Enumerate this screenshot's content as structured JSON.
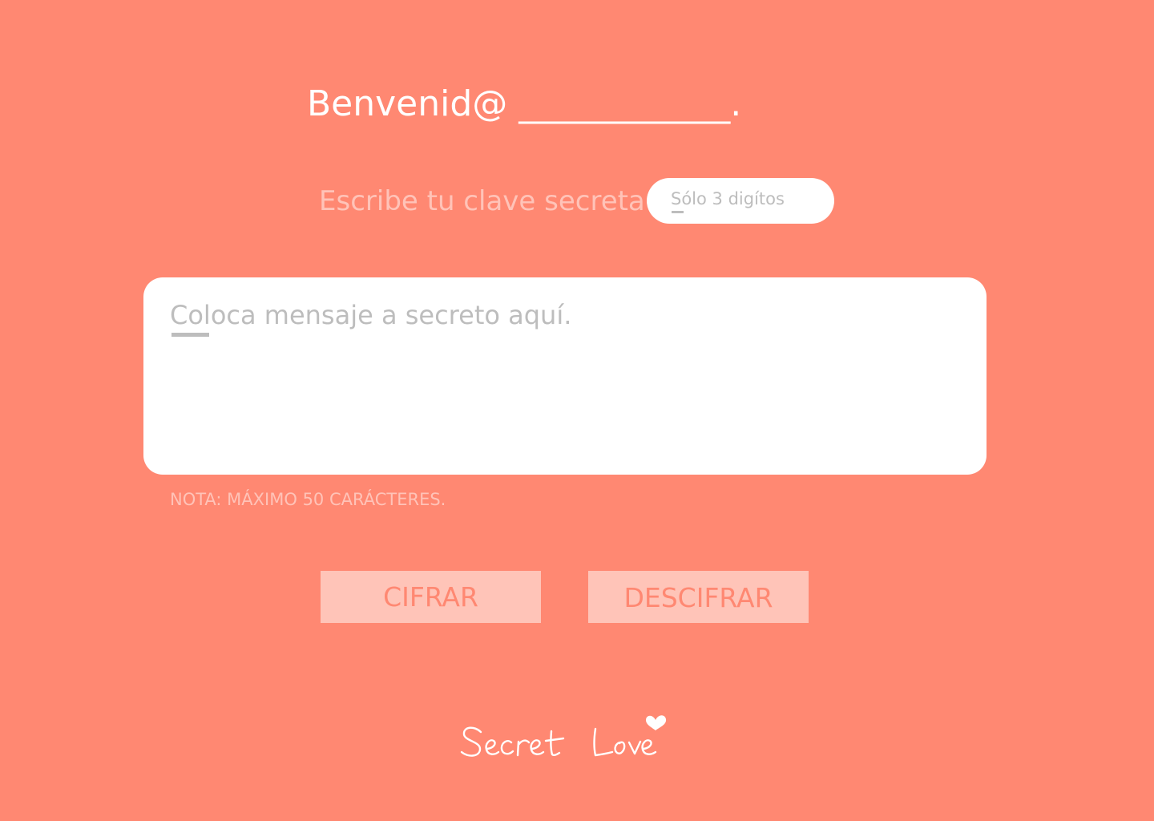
{
  "header": {
    "welcome_text": "Benvenid@ ____________."
  },
  "key": {
    "label": "Escribe tu clave secreta",
    "placeholder": "Sólo 3 digítos",
    "value": ""
  },
  "message": {
    "placeholder": "Coloca mensaje a secreto aquí.",
    "value": "",
    "note": "NOTA: MÁXIMO 50 CARÁCTERES."
  },
  "actions": {
    "encrypt_label": "CIFRAR",
    "decrypt_label": "DESCIFRAR"
  },
  "footer": {
    "logo_text": "Secret Love",
    "logo_icon": "heart-icon"
  },
  "colors": {
    "background": "#FF8872",
    "accent_light": "#FFC4B8",
    "field": "#FFFFFF",
    "placeholder": "#BDBDBD"
  }
}
